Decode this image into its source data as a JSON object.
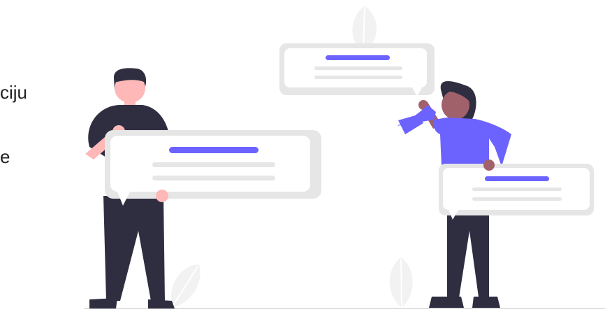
{
  "text_fragments": {
    "line_1": "ciju",
    "line_2": "e"
  },
  "colors": {
    "accent": "#6c63ff",
    "bubble_gray": "#e6e6e6",
    "bubble_white": "#ffffff",
    "bubble_line": "#e6e6e6",
    "dark": "#2f2e41",
    "skin_light": "#ffb8b8",
    "skin_dark": "#a0616a",
    "leaf": "#f2f2f2",
    "ground": "#e0e0e0"
  },
  "illustration": {
    "figures": [
      "man-holding-chat-bubble",
      "woman-holding-chat-bubble"
    ],
    "chat_bubbles": 3,
    "leaves": 3
  }
}
